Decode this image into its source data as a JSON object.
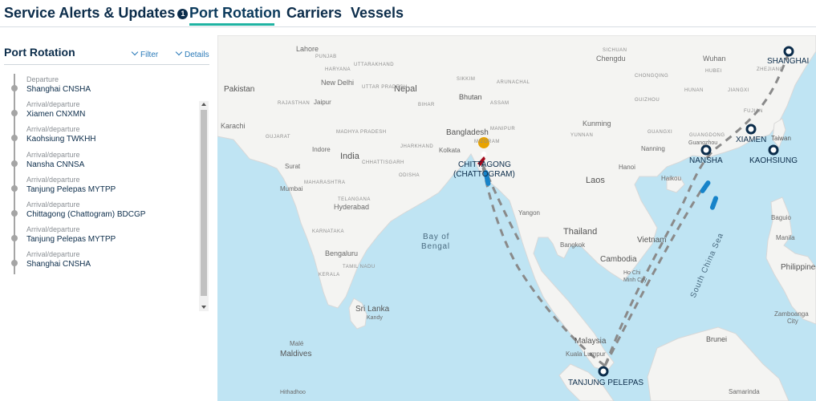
{
  "tabs": {
    "service_alerts": "Service Alerts & Updates",
    "service_alerts_badge": "1",
    "port_rotation": "Port Rotation",
    "carriers": "Carriers",
    "vessels": "Vessels"
  },
  "panel": {
    "title": "Port Rotation",
    "filter": "Filter",
    "details": "Details",
    "stops": [
      {
        "type": "Departure",
        "port": "Shanghai  CNSHA"
      },
      {
        "type": "Arrival/departure",
        "port": "Xiamen  CNXMN"
      },
      {
        "type": "Arrival/departure",
        "port": "Kaohsiung  TWKHH"
      },
      {
        "type": "Arrival/departure",
        "port": "Nansha  CNNSA"
      },
      {
        "type": "Arrival/departure",
        "port": "Tanjung Pelepas  MYTPP"
      },
      {
        "type": "Arrival/departure",
        "port": "Chittagong (Chattogram)  BDCGP"
      },
      {
        "type": "Arrival/departure",
        "port": "Tanjung Pelepas  MYTPP"
      },
      {
        "type": "Arrival/departure",
        "port": "Shanghai  CNSHA"
      }
    ]
  },
  "map": {
    "ports": {
      "shanghai": "SHANGHAI",
      "xiamen": "XIAMEN",
      "nansha": "NANSHA",
      "kaohsiung": "KAOHSIUNG",
      "chittagong_1": "CHITTAGONG",
      "chittagong_2": "(CHATTOGRAM)",
      "tanjung_pelepas": "TANJUNG PELEPAS"
    },
    "countries": {
      "pakistan": "Pakistan",
      "nepal": "Nepal",
      "bhutan": "Bhutan",
      "bangladesh": "Bangladesh",
      "india": "India",
      "laos": "Laos",
      "thailand": "Thailand",
      "vietnam": "Vietnam",
      "cambodia": "Cambodia",
      "sri_lanka": "Sri Lanka",
      "maldives": "Maldives",
      "malaysia": "Malaysia",
      "philippines": "Philippines",
      "brunei": "Brunei",
      "taiwan": "Taiwan"
    },
    "cities": {
      "lahore": "Lahore",
      "new_delhi": "New Delhi",
      "jaipur": "Jaipur",
      "karachi": "Karachi",
      "indore": "Indore",
      "surat": "Surat",
      "mumbai": "Mumbai",
      "hyderabad": "Hyderabad",
      "bengaluru": "Bengaluru",
      "kolkata": "Kolkata",
      "male": "Malé",
      "hithadhoo": "Hithadhoo",
      "chengdu": "Chengdu",
      "wuhan": "Wuhan",
      "kunming": "Kunming",
      "nanning": "Nanning",
      "guangzhou": "Guangzhou",
      "hanoi": "Hanoi",
      "haikou": "Haikou",
      "yangon": "Yangon",
      "bangkok": "Bangkok",
      "ho_chi_minh": "Ho Chi",
      "ho_chi_minh_2": "Minh City",
      "kuala_lumpur": "Kuala Lumpur",
      "baguio": "Baguio",
      "manila": "Manila",
      "zamboanga": "Zamboanga",
      "zamboanga_2": "City",
      "samarinda": "Samarinda",
      "kandy": "Kandy"
    },
    "regions": {
      "punjab": "PUNJAB",
      "haryana": "HARYANA",
      "uttar_pradesh": "UTTAR PRADESH",
      "rajasthan": "RAJASTHAN",
      "uttarakhand": "UTTARAKHAND",
      "madhya_pradesh": "MADHYA PRADESH",
      "gujarat": "GUJARAT",
      "maharashtra": "MAHARASHTRA",
      "telangana": "TELANGANA",
      "karnataka": "KARNATAKA",
      "tamil_nadu": "TAMIL NADU",
      "kerala": "KERALA",
      "chhattisgarh": "CHHATTISGARH",
      "jharkhand": "JHARKHAND",
      "odisha": "ODISHA",
      "bihar": "BIHAR",
      "sikkim": "SIKKIM",
      "arunachal": "ARUNACHAL",
      "assam": "ASSAM",
      "manipur": "MANIPUR",
      "mizoram": "MIZORAM",
      "sichuan": "SICHUAN",
      "hubei": "HUBEI",
      "chongqing": "CHONGQING",
      "hunan": "HUNAN",
      "guizhou": "GUIZHOU",
      "yunnan": "YUNNAN",
      "guangdong": "GUANGDONG",
      "guangxi": "GUANGXI",
      "jiangxi": "JIANGXI",
      "fujian": "FUJIAN",
      "zhejiang": "ZHEJIANG"
    },
    "seas": {
      "bay_of_bengal_1": "Bay of",
      "bay_of_bengal_2": "Bengal",
      "south_china_sea": "South China Sea"
    }
  }
}
